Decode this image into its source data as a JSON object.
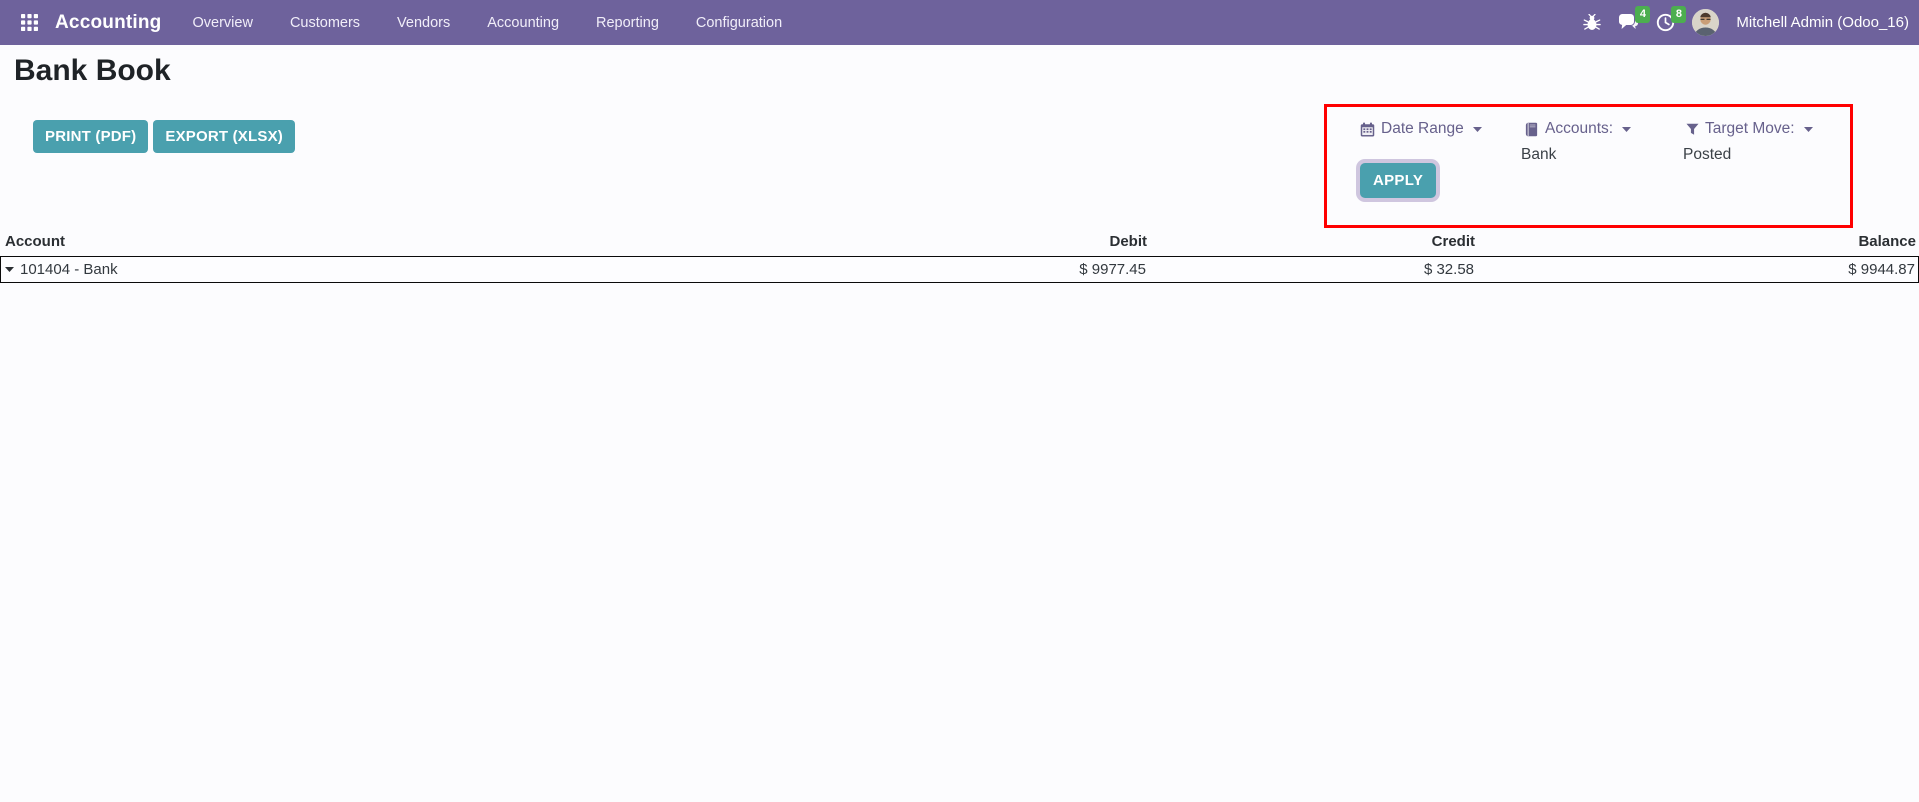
{
  "nav": {
    "app_name": "Accounting",
    "menu_items": [
      "Overview",
      "Customers",
      "Vendors",
      "Accounting",
      "Reporting",
      "Configuration"
    ],
    "messages_badge": "4",
    "activities_badge": "8",
    "user_name": "Mitchell Admin (Odoo_16)"
  },
  "page": {
    "title": "Bank Book",
    "print_button": "PRINT (PDF)",
    "export_button": "EXPORT (XLSX)"
  },
  "filters": {
    "date_range_label": "Date Range",
    "accounts_label": "Accounts:",
    "accounts_value": "Bank",
    "target_move_label": "Target Move:",
    "target_move_value": "Posted",
    "apply_button": "APPLY"
  },
  "table": {
    "headers": [
      "Account",
      "Debit",
      "Credit",
      "Balance"
    ],
    "rows": [
      {
        "account": "101404 - Bank",
        "debit": "$ 9977.45",
        "credit": "$ 32.58",
        "balance": "$ 9944.87"
      }
    ]
  },
  "colors": {
    "navBg": "#6e629c",
    "teal": "#4aa0ae",
    "badgeGreen": "#4cae4f",
    "red": "#ff0000",
    "filterLabel": "#67618c",
    "textDark": "#33393f"
  }
}
